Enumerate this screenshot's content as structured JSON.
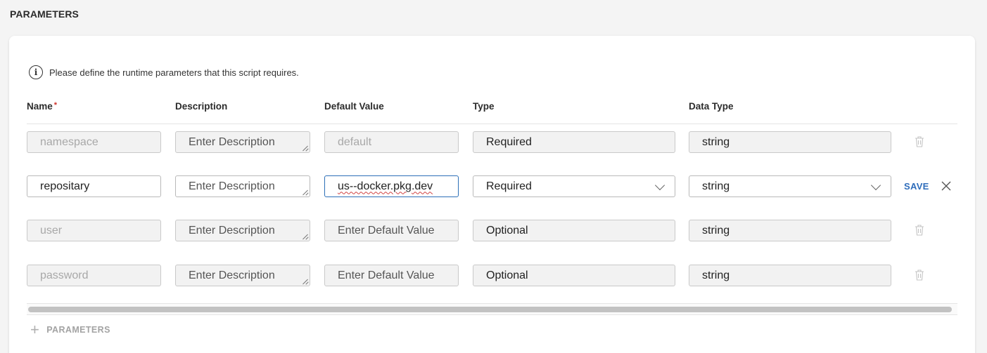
{
  "section": {
    "title": "PARAMETERS"
  },
  "info": {
    "text": "Please define the runtime parameters that this script requires."
  },
  "columns": {
    "name": "Name",
    "required_marker": "*",
    "description": "Description",
    "default_value": "Default Value",
    "type": "Type",
    "data_type": "Data Type"
  },
  "rows": [
    {
      "name": "namespace",
      "description_placeholder": "Enter Description",
      "default_value": "default",
      "type": "Required",
      "data_type": "string",
      "editing": false
    },
    {
      "name": "repositary",
      "description_placeholder": "Enter Description",
      "default_value": "us--docker.pkg.dev",
      "type": "Required",
      "data_type": "string",
      "editing": true
    },
    {
      "name": "user",
      "description_placeholder": "Enter Description",
      "default_value_placeholder": "Enter Default Value",
      "type": "Optional",
      "data_type": "string",
      "editing": false
    },
    {
      "name": "password",
      "description_placeholder": "Enter Description",
      "default_value_placeholder": "Enter Default Value",
      "type": "Optional",
      "data_type": "string",
      "editing": false
    }
  ],
  "actions": {
    "save_label": "SAVE",
    "add_label": "PARAMETERS"
  },
  "colors": {
    "accent": "#2f6dbb",
    "required": "#d0342c",
    "focus_border": "#2c6fb7"
  },
  "icons": [
    "info-icon",
    "trash-icon",
    "close-icon",
    "chevron-down-icon",
    "plus-icon"
  ]
}
